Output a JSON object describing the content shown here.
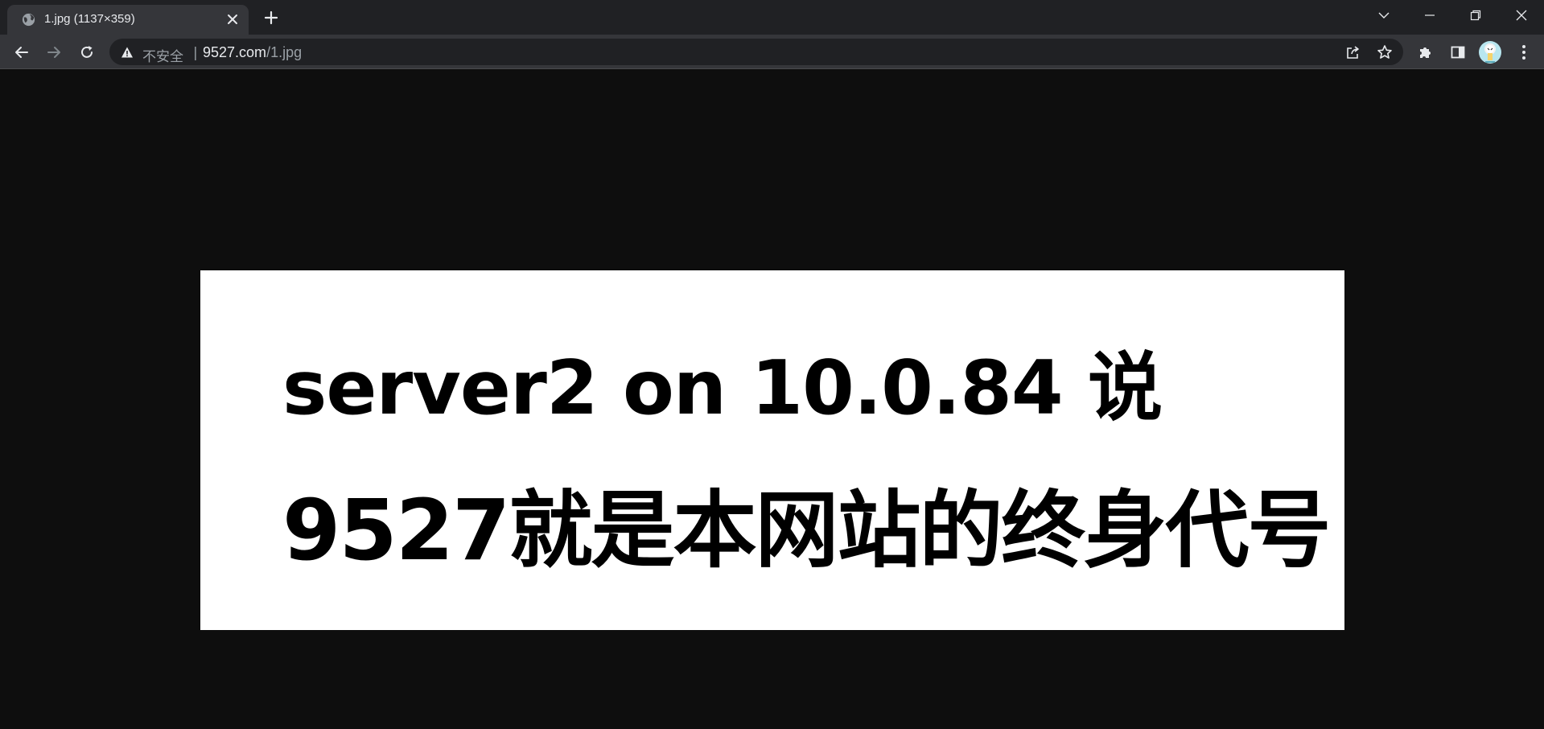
{
  "tab": {
    "title": "1.jpg (1137×359)"
  },
  "omnibox": {
    "security_label": "不安全",
    "separator": "|",
    "url_host": "9527.com",
    "url_path": "/1.jpg"
  },
  "image": {
    "line1": "server2 on 10.0.84 说",
    "line2": "9527就是本网站的终身代号"
  },
  "colors": {
    "tabstrip_bg": "#202124",
    "toolbar_bg": "#35363a",
    "omnibox_bg": "#202124",
    "viewer_bg": "#0e0e0e",
    "icon": "#e8eaed"
  },
  "icons": {
    "tab_favicon": "globe-icon",
    "tab_close": "close-icon",
    "new_tab": "plus-icon",
    "tab_search": "chevron-down-icon",
    "minimize": "minimize-icon",
    "restore": "restore-icon",
    "close_window": "close-icon",
    "back": "back-arrow-icon",
    "forward": "forward-arrow-icon",
    "reload": "reload-icon",
    "not_secure": "warning-triangle-icon",
    "share": "share-icon",
    "bookmark": "star-icon",
    "extensions": "puzzle-icon",
    "side_panel": "side-panel-icon",
    "menu": "kebab-menu-icon"
  }
}
